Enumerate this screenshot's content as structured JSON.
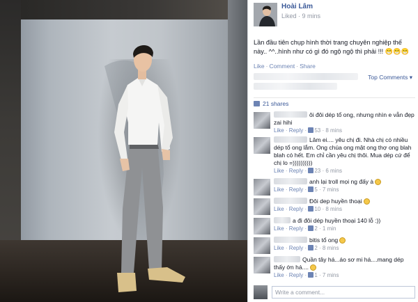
{
  "post": {
    "author": "Hoài Lâm",
    "status": "Liked",
    "time": "9 mins",
    "text": "Lần đầu tiên chụp hình thời trang chuyên nghiệp thế này.. ^^..hình như có gì đó ngộ ngộ thì phải !!! 😁😁😁",
    "actions": {
      "like": "Like",
      "comment": "Comment",
      "share": "Share"
    },
    "top_comments": "Top Comments",
    "shares": "21 shares"
  },
  "comments": [
    {
      "text": "ôi đôi dép tổ ong, nhưng nhìn e vẫn đẹp zai hihi",
      "likes": "53",
      "time": "8 mins"
    },
    {
      "text": "Lâm ei.... yêu chị đi. Nhà chị có nhiều dép tổ ong lắm. Ong chúa ong mật ong thợ ong blah blah có hết. Em chỉ cần yêu chị thôi. Mua dép cứ để chị lo =))))))))))",
      "likes": "23",
      "time": "6 mins"
    },
    {
      "text": "anh lại troll mọi ng đấy à",
      "likes": "5",
      "time": "7 mins",
      "smiley": true
    },
    {
      "text": "Đôi dep huyền thoại",
      "likes": "10",
      "time": "8 mins",
      "smiley": true
    },
    {
      "text": "a đi đôi dép huyền thoại 140 lỗ :))",
      "likes": "2",
      "time": "1 min"
    },
    {
      "text": "bitis tổ ong",
      "likes": "2",
      "time": "8 mins",
      "smiley": true
    },
    {
      "text": "Quần tây há...áo sơ mi há....mang dép thấy ớn há....",
      "likes": "1",
      "time": "7 mins",
      "smiley": true
    }
  ],
  "meta_labels": {
    "like": "Like",
    "reply": "Reply"
  },
  "write": {
    "placeholder": "Write a comment..."
  },
  "colors": {
    "link": "#3b5998",
    "muted": "#9197a3",
    "accent": "#6d84b4"
  }
}
